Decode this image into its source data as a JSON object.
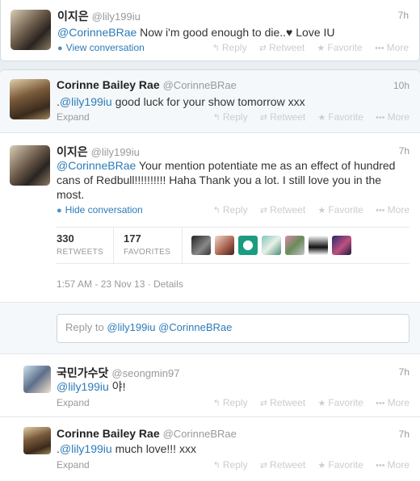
{
  "tweet1": {
    "name": "이지은",
    "handle": "@lily199iu",
    "time": "7h",
    "mention": "@CorinneBRae",
    "text": " Now i'm good enough to die..♥ Love IU",
    "link": "View conversation"
  },
  "actions": {
    "reply": "Reply",
    "retweet": "Retweet",
    "favorite": "Favorite",
    "more": "More"
  },
  "tweet2": {
    "name": "Corinne Bailey Rae",
    "handle": "@CorinneBRae",
    "time": "10h",
    "prefix": ".",
    "mention": "@lily199iu",
    "text": " good luck for your show tomorrow xxx",
    "link": "Expand"
  },
  "tweet3": {
    "name": "이지은",
    "handle": "@lily199iu",
    "time": "7h",
    "mention": "@CorinneBRae",
    "text": " Your mention potentiate me as an effect of hundred cans of Redbull!!!!!!!!!! Haha Thank you a lot. I still love you in the most.",
    "link": "Hide conversation",
    "retweets": "330",
    "retweets_label": "RETWEETS",
    "favorites": "177",
    "favorites_label": "FAVORITES",
    "timestamp": "1:57 AM - 23 Nov 13",
    "details": "Details"
  },
  "reply": {
    "prefix": "Reply to ",
    "mentions": "@lily199iu @CorinneBRae"
  },
  "tweet4": {
    "name": "국민가수닷",
    "handle": "@seongmin97",
    "time": "7h",
    "mention": "@lily199iu",
    "text": " 야!",
    "link": "Expand"
  },
  "tweet5": {
    "name": "Corinne Bailey Rae",
    "handle": "@CorinneBRae",
    "time": "7h",
    "prefix": ".",
    "mention": "@lily199iu",
    "text": " much love!!! xxx",
    "link": "Expand"
  },
  "colors": {
    "link": "#2b7bb9",
    "muted": "#999999",
    "background": "#e9eef2"
  }
}
